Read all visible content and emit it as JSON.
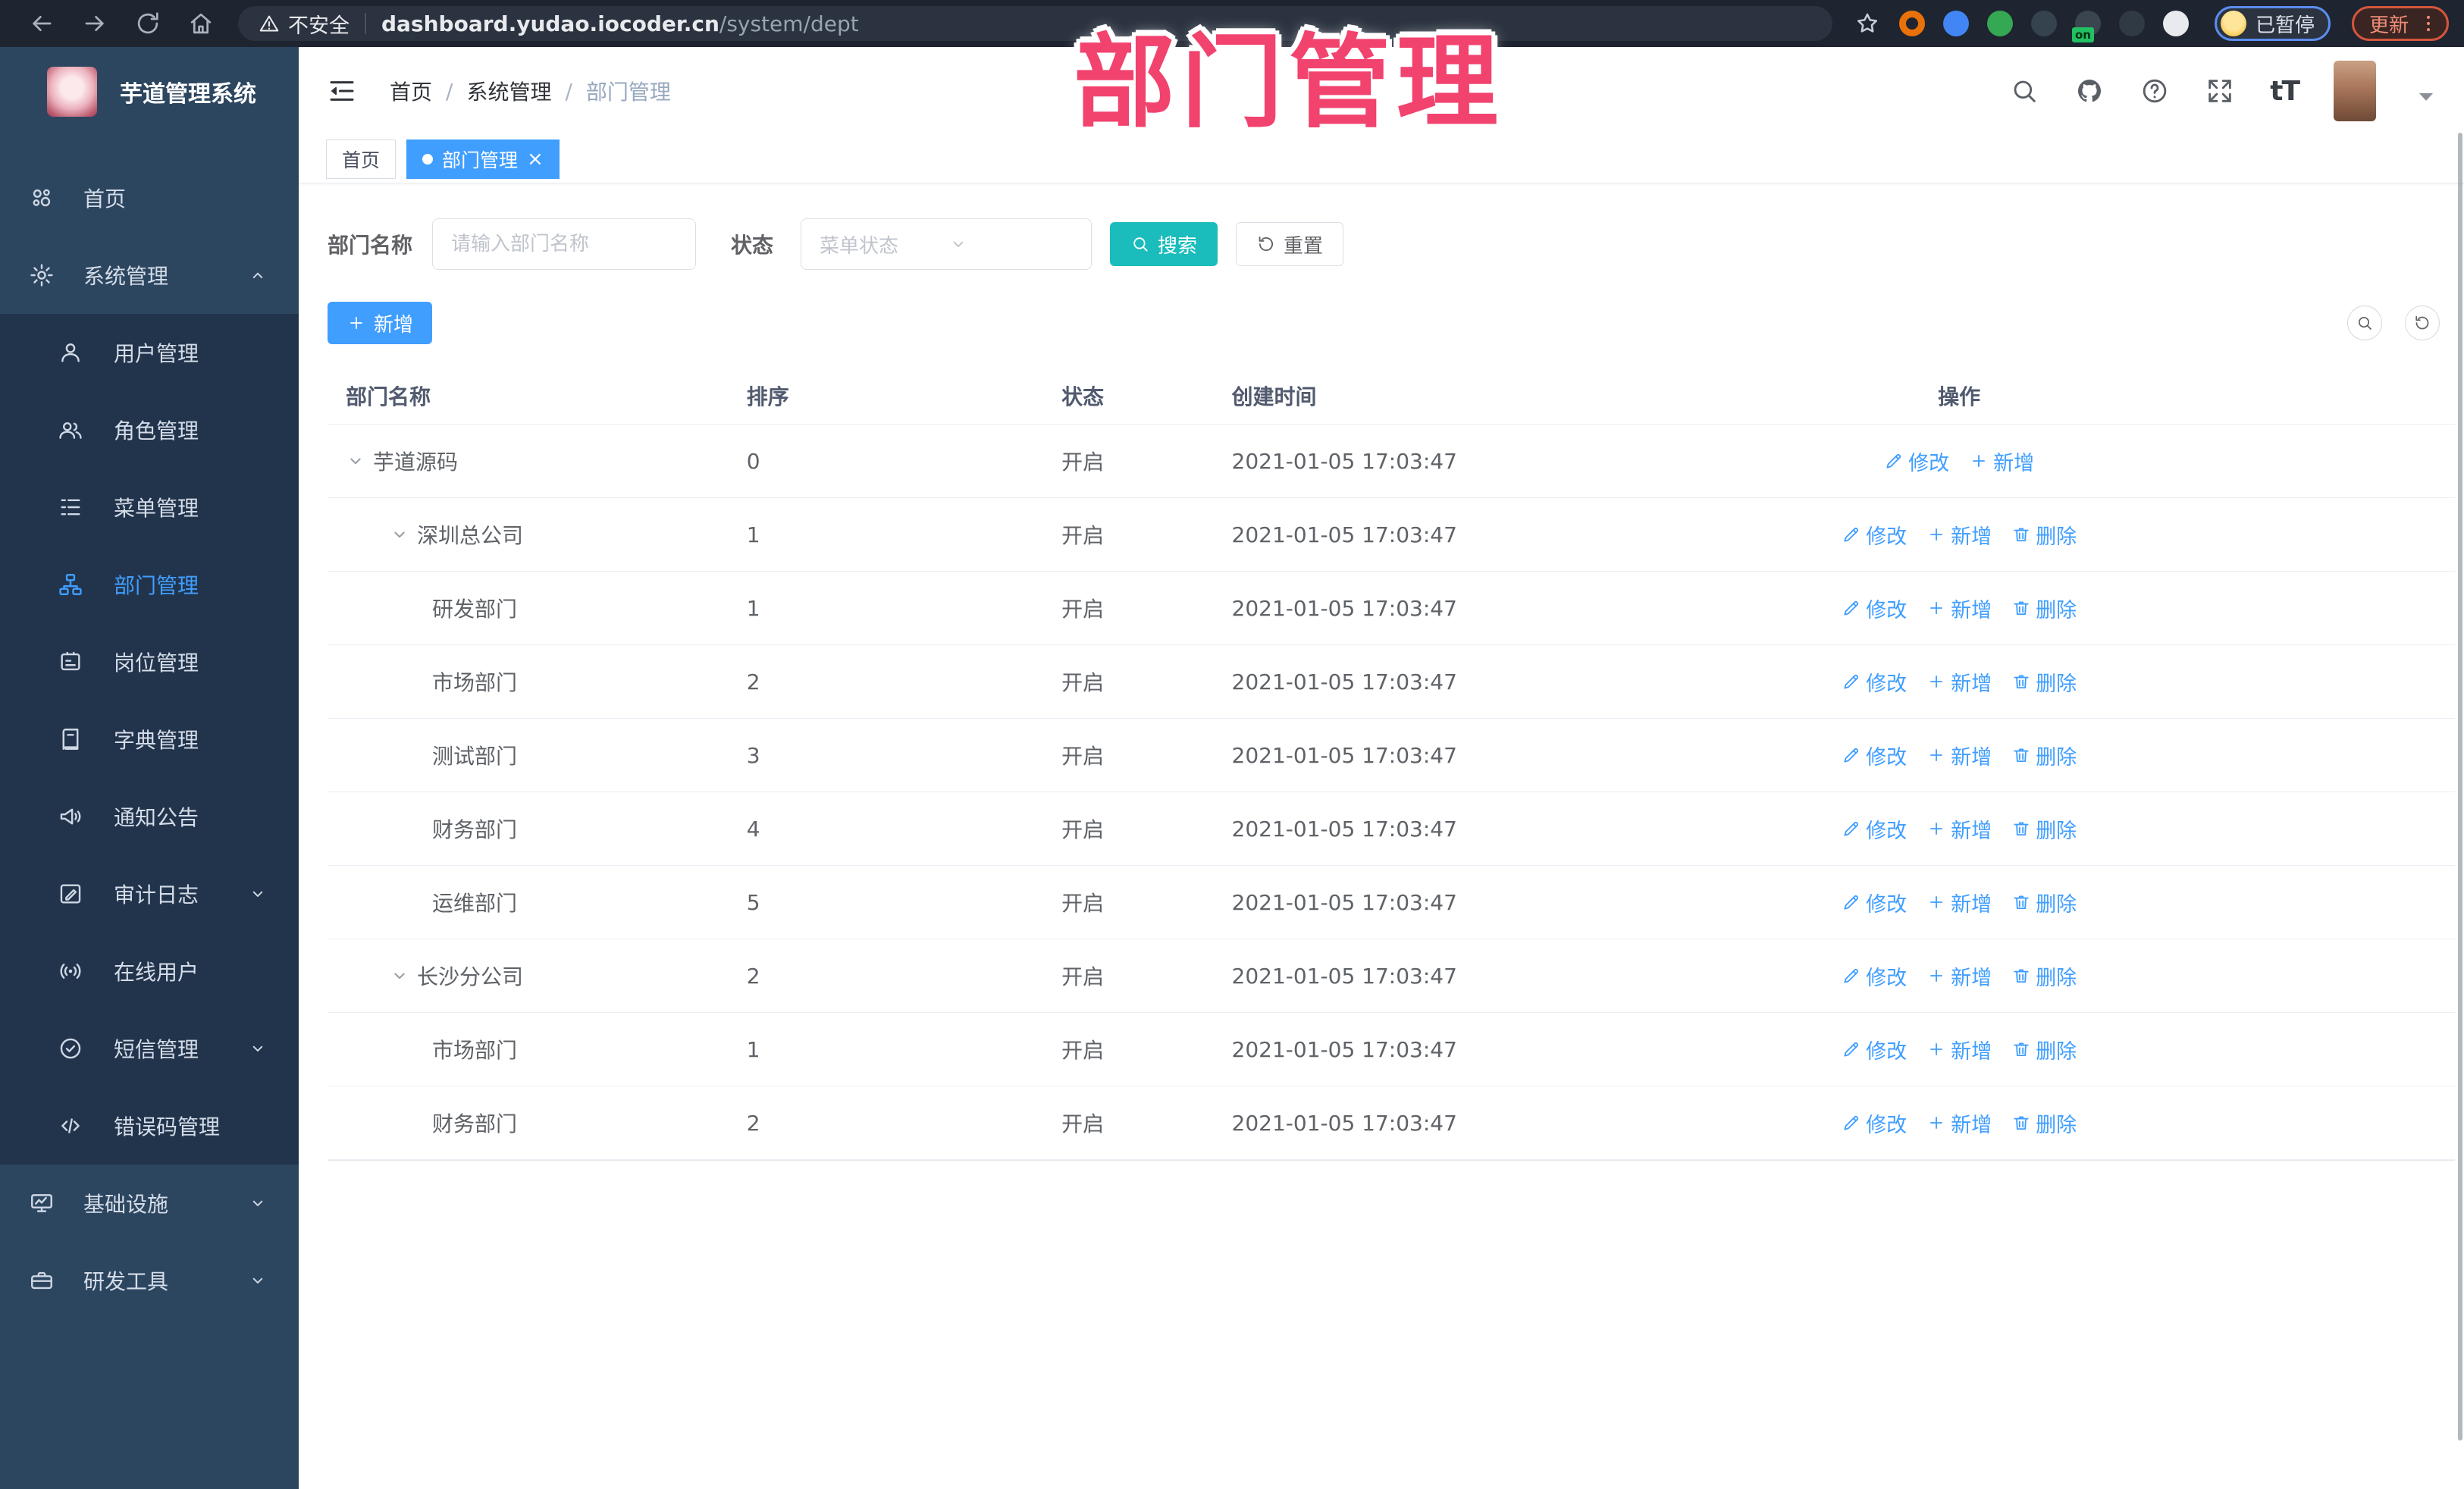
{
  "browser": {
    "security_label": "不安全",
    "url_host": "dashboard.yudao.iocoder.cn",
    "url_path": "/system/dept",
    "profile_chip_label": "已暂停",
    "update_label": "更新",
    "extensions": [
      {
        "name": "extension-orange-icon",
        "color": "#e8710a",
        "ring": true
      },
      {
        "name": "extension-blue-gem-icon",
        "color": "#4285f4"
      },
      {
        "name": "extension-green-check-icon",
        "color": "#34a853"
      },
      {
        "name": "extension-tiles-icon",
        "color": "#35434f"
      },
      {
        "name": "extension-switch-icon",
        "color": "#3a4550",
        "badge": "on"
      },
      {
        "name": "extension-key-icon",
        "color": "#2f3a44"
      },
      {
        "name": "extension-puzzle-icon",
        "color": "#e8eaed"
      }
    ]
  },
  "annotation": {
    "text": "部门管理"
  },
  "sidebar": {
    "title": "芋道管理系统",
    "items": [
      {
        "name": "home",
        "label": "首页",
        "icon": "dashboard",
        "type": "top"
      },
      {
        "name": "system-management",
        "label": "系统管理",
        "icon": "gear",
        "type": "top",
        "chevron": "up"
      },
      {
        "name": "user-management",
        "label": "用户管理",
        "icon": "user",
        "type": "sub"
      },
      {
        "name": "role-management",
        "label": "角色管理",
        "icon": "users",
        "type": "sub"
      },
      {
        "name": "menu-management",
        "label": "菜单管理",
        "icon": "menu-list",
        "type": "sub"
      },
      {
        "name": "dept-management",
        "label": "部门管理",
        "icon": "dept-tree",
        "type": "sub",
        "active": true
      },
      {
        "name": "post-management",
        "label": "岗位管理",
        "icon": "post-badge",
        "type": "sub"
      },
      {
        "name": "dict-management",
        "label": "字典管理",
        "icon": "dict-book",
        "type": "sub"
      },
      {
        "name": "notice-announcement",
        "label": "通知公告",
        "icon": "notice",
        "type": "sub"
      },
      {
        "name": "audit-log",
        "label": "审计日志",
        "icon": "log-edit",
        "type": "sub",
        "chevron": "down"
      },
      {
        "name": "online-users",
        "label": "在线用户",
        "icon": "online",
        "type": "sub"
      },
      {
        "name": "sms-management",
        "label": "短信管理",
        "icon": "sms",
        "type": "sub",
        "chevron": "down"
      },
      {
        "name": "error-code-management",
        "label": "错误码管理",
        "icon": "code",
        "type": "sub"
      },
      {
        "name": "infrastructure",
        "label": "基础设施",
        "icon": "monitor",
        "type": "top",
        "chevron": "down"
      },
      {
        "name": "dev-tools",
        "label": "研发工具",
        "icon": "toolbox",
        "type": "top",
        "chevron": "down"
      }
    ]
  },
  "header": {
    "breadcrumb": [
      "首页",
      "系统管理",
      "部门管理"
    ],
    "font_size_label": "tT"
  },
  "tabs": [
    {
      "label": "首页",
      "active": false,
      "closable": false
    },
    {
      "label": "部门管理",
      "active": true,
      "closable": true
    }
  ],
  "filters": {
    "dept_name_label": "部门名称",
    "dept_name_placeholder": "请输入部门名称",
    "dept_name_value": "",
    "status_label": "状态",
    "status_placeholder": "菜单状态",
    "search_label": "搜索",
    "reset_label": "重置"
  },
  "toolbar": {
    "add_label": "新增"
  },
  "table": {
    "columns": [
      "部门名称",
      "排序",
      "状态",
      "创建时间",
      "操作"
    ],
    "action_labels": {
      "edit": "修改",
      "add": "新增",
      "delete": "删除"
    },
    "rows": [
      {
        "name": "芋道源码",
        "level": 0,
        "expandable": true,
        "sort": "0",
        "status": "开启",
        "created": "2021-01-05 17:03:47",
        "actions": [
          "edit",
          "add"
        ]
      },
      {
        "name": "深圳总公司",
        "level": 1,
        "expandable": true,
        "sort": "1",
        "status": "开启",
        "created": "2021-01-05 17:03:47",
        "actions": [
          "edit",
          "add",
          "delete"
        ]
      },
      {
        "name": "研发部门",
        "level": 2,
        "expandable": false,
        "sort": "1",
        "status": "开启",
        "created": "2021-01-05 17:03:47",
        "actions": [
          "edit",
          "add",
          "delete"
        ]
      },
      {
        "name": "市场部门",
        "level": 2,
        "expandable": false,
        "sort": "2",
        "status": "开启",
        "created": "2021-01-05 17:03:47",
        "actions": [
          "edit",
          "add",
          "delete"
        ]
      },
      {
        "name": "测试部门",
        "level": 2,
        "expandable": false,
        "sort": "3",
        "status": "开启",
        "created": "2021-01-05 17:03:47",
        "actions": [
          "edit",
          "add",
          "delete"
        ]
      },
      {
        "name": "财务部门",
        "level": 2,
        "expandable": false,
        "sort": "4",
        "status": "开启",
        "created": "2021-01-05 17:03:47",
        "actions": [
          "edit",
          "add",
          "delete"
        ]
      },
      {
        "name": "运维部门",
        "level": 2,
        "expandable": false,
        "sort": "5",
        "status": "开启",
        "created": "2021-01-05 17:03:47",
        "actions": [
          "edit",
          "add",
          "delete"
        ]
      },
      {
        "name": "长沙分公司",
        "level": 1,
        "expandable": true,
        "sort": "2",
        "status": "开启",
        "created": "2021-01-05 17:03:47",
        "actions": [
          "edit",
          "add",
          "delete"
        ]
      },
      {
        "name": "市场部门",
        "level": 2,
        "expandable": false,
        "sort": "1",
        "status": "开启",
        "created": "2021-01-05 17:03:47",
        "actions": [
          "edit",
          "add",
          "delete"
        ]
      },
      {
        "name": "财务部门",
        "level": 2,
        "expandable": false,
        "sort": "2",
        "status": "开启",
        "created": "2021-01-05 17:03:47",
        "actions": [
          "edit",
          "add",
          "delete"
        ]
      }
    ]
  },
  "colors": {
    "primary": "#409eff",
    "teal": "#1abcbc",
    "sidebar-bg": "#2d4660",
    "submenu-bg": "#22344c",
    "annotation": "#f2426e",
    "chrome-bg": "#1e2430"
  }
}
